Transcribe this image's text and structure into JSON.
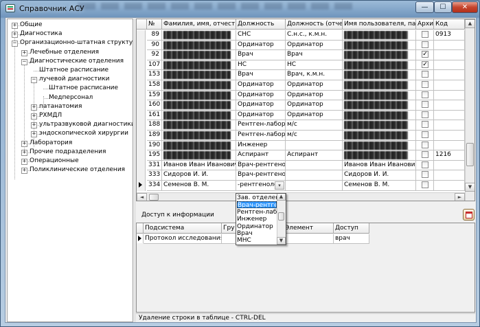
{
  "window": {
    "title": "Справочник АСУ",
    "minimize": "—",
    "maximize": "☐",
    "close": "✕"
  },
  "tree": [
    {
      "label": "Общие",
      "expander": "+"
    },
    {
      "label": "Диагностика",
      "expander": "+"
    },
    {
      "label": "Организационно-штатная структура",
      "expander": "−"
    },
    {
      "label": "Лечебные отделения",
      "expander": "+"
    },
    {
      "label": "Диагностические отделения",
      "expander": "−"
    },
    {
      "label": "Штатное расписание",
      "expander": ""
    },
    {
      "label": "лучевой диагностики",
      "expander": "−"
    },
    {
      "label": "Штатное расписание",
      "expander": ""
    },
    {
      "label": "Медперсонал",
      "expander": ""
    },
    {
      "label": "патанатомия",
      "expander": "+"
    },
    {
      "label": "РХМДЛ",
      "expander": "+"
    },
    {
      "label": "ультразвуковой диагностики",
      "expander": "+"
    },
    {
      "label": "эндоскопической хирургии",
      "expander": "+"
    },
    {
      "label": "Лаборатория",
      "expander": "+"
    },
    {
      "label": "Прочие подразделения",
      "expander": "+"
    },
    {
      "label": "Операционные",
      "expander": "+"
    },
    {
      "label": "Поликлинические отделения",
      "expander": "+"
    }
  ],
  "grid": {
    "headers": [
      "№",
      "Фамилия, имя, отчество",
      "Должность",
      "Должность (отчет)",
      "Имя пользователя, паро",
      "Архив",
      "Код"
    ],
    "rows": [
      {
        "num": "89",
        "name": "",
        "pos": "СНС",
        "rep": "С.н.с., к.м.н.",
        "user": "",
        "archive": false,
        "code": "0913"
      },
      {
        "num": "90",
        "name": "",
        "pos": "Ординатор",
        "rep": "Ординатор",
        "user": "",
        "archive": false,
        "code": ""
      },
      {
        "num": "92",
        "name": "",
        "pos": "Врач",
        "rep": "Врач",
        "user": "",
        "archive": true,
        "code": ""
      },
      {
        "num": "107",
        "name": "",
        "pos": "НС",
        "rep": "НС",
        "user": "",
        "archive": true,
        "code": ""
      },
      {
        "num": "153",
        "name": "",
        "pos": "Врач",
        "rep": "Врач, к.м.н.",
        "user": "",
        "archive": false,
        "code": ""
      },
      {
        "num": "158",
        "name": "",
        "pos": "Ординатор",
        "rep": "Ординатор",
        "user": "",
        "archive": false,
        "code": ""
      },
      {
        "num": "159",
        "name": "",
        "pos": "Ординатор",
        "rep": "Ординатор",
        "user": "",
        "archive": false,
        "code": ""
      },
      {
        "num": "160",
        "name": "",
        "pos": "Ординатор",
        "rep": "Ординатор",
        "user": "",
        "archive": false,
        "code": ""
      },
      {
        "num": "161",
        "name": "",
        "pos": "Ординатор",
        "rep": "Ординатор",
        "user": "",
        "archive": false,
        "code": ""
      },
      {
        "num": "188",
        "name": "",
        "pos": "Рентген-лаборан",
        "rep": "м/с",
        "user": "",
        "archive": false,
        "code": ""
      },
      {
        "num": "189",
        "name": "",
        "pos": "Рентген-лаборан",
        "rep": "м/с",
        "user": "",
        "archive": false,
        "code": ""
      },
      {
        "num": "190",
        "name": "",
        "pos": "Инженер",
        "rep": "",
        "user": "",
        "archive": false,
        "code": ""
      },
      {
        "num": "195",
        "name": "",
        "pos": "Аспирант",
        "rep": "Аспирант",
        "user": "",
        "archive": false,
        "code": "1216"
      },
      {
        "num": "331",
        "name": "Иванов Иван Иванович",
        "pos": "Врач-рентгеноло",
        "rep": "",
        "user": "Иванов Иван Иванович",
        "archive": false,
        "code": ""
      },
      {
        "num": "333",
        "name": "Сидоров И. И.",
        "pos": "Врач-рентгеноло",
        "rep": "",
        "user": "Сидоров И. И.",
        "archive": false,
        "code": ""
      },
      {
        "num": "334",
        "name": "Семенов В. М.",
        "pos": "-рентгенолог",
        "rep": "",
        "user": "Семенов В. М.",
        "archive": false,
        "code": ""
      }
    ],
    "combo_arrow": "▾"
  },
  "dropdown": {
    "items": [
      "Зав. отделен",
      "Врач-рентген",
      "Рентген-лабо",
      "Инженер",
      "Ординатор",
      "Врач",
      "МНС"
    ],
    "selected_index": 1
  },
  "access": {
    "label": "Доступ к информации",
    "headers": [
      "Подсистема",
      "Гру",
      "Элемент",
      "Доступ"
    ],
    "rows": [
      {
        "subsystem": "Протокол исследования ди",
        "group": "",
        "element": "",
        "access": "врач"
      }
    ]
  },
  "status": "Удаление строки в таблице - CTRL-DEL"
}
